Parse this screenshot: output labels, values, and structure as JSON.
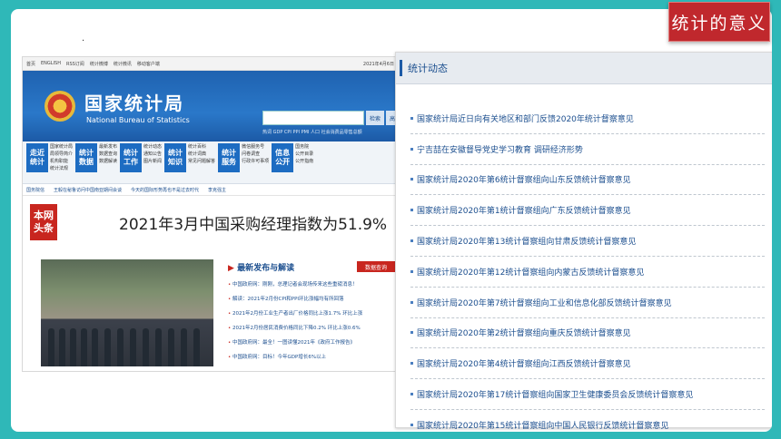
{
  "slide_title": "统计的意义",
  "left": {
    "topbar": [
      "首页",
      "ENGLISH",
      "RSS订阅",
      "统计微博",
      "统计微讯",
      "移动客户端"
    ],
    "topbar_date": "2021年4月6日",
    "brand_cn": "国家统计局",
    "brand_en": "National Bureau of Statistics",
    "search_btn": "检索",
    "adv_btn": "高级",
    "hot": "热词  GDP  CPI  PPI  PMI  人口  社会消费品零售总额",
    "nav": [
      {
        "label": "走近统计",
        "subs": [
          "国家统计局",
          "局领导简介",
          "机构职能",
          "统计法规"
        ]
      },
      {
        "label": "统计数据",
        "subs": [
          "最新发布",
          "数据查询",
          "数据解读"
        ]
      },
      {
        "label": "统计工作",
        "subs": [
          "统计动态",
          "通知公告",
          "图片新闻"
        ]
      },
      {
        "label": "统计知识",
        "subs": [
          "统计百科",
          "统计词典",
          "常见问题解答"
        ]
      },
      {
        "label": "统计服务",
        "subs": [
          "微信服务号",
          "问卷调查",
          "行政许可事项"
        ]
      },
      {
        "label": "信息公开",
        "subs": [
          "国务院",
          "公开目录",
          "公开指南"
        ]
      }
    ],
    "ticker": [
      "国务院信",
      "王毅在秘鲁访问中国南亚期间会谈",
      "今天的国际形势再也不是过去时代",
      "李克强主"
    ],
    "tag": "本网头条",
    "headline": "2021年3月中国采购经理指数为51.9%",
    "news_head": "最新发布与解读",
    "news_btn": "数据查询",
    "news": [
      "中国政府网：刚刚，总理记者会现场传来这些重磅消息！",
      "解读：2021年2月份CPI和PPI环比涨幅均有所回落",
      "2021年2月份工业生产者出厂价格同比上涨1.7% 环比上涨",
      "2021年2月份居民消费价格同比下降0.2% 环比上涨0.6%",
      "中国政府网：最全！一图读懂2021年《政府工作报告》",
      "中国政府网：目标！今年GDP增长6%以上"
    ]
  },
  "right": {
    "title": "统计动态",
    "items": [
      "国家统计局近日向有关地区和部门反馈2020年统计督察意见",
      "宁吉喆在安徽督导党史学习教育 调研经济形势",
      "国家统计局2020年第6统计督察组向山东反馈统计督察意见",
      "国家统计局2020年第1统计督察组向广东反馈统计督察意见",
      "国家统计局2020年第13统计督察组向甘肃反馈统计督察意见",
      "国家统计局2020年第12统计督察组向内蒙古反馈统计督察意见",
      "国家统计局2020年第7统计督察组向工业和信息化部反馈统计督察意见",
      "国家统计局2020年第2统计督察组向重庆反馈统计督察意见",
      "国家统计局2020年第4统计督察组向江西反馈统计督察意见",
      "国家统计局2020年第17统计督察组向国家卫生健康委员会反馈统计督察意见",
      "国家统计局2020年第15统计督察组向中国人民银行反馈统计督察意见"
    ]
  }
}
